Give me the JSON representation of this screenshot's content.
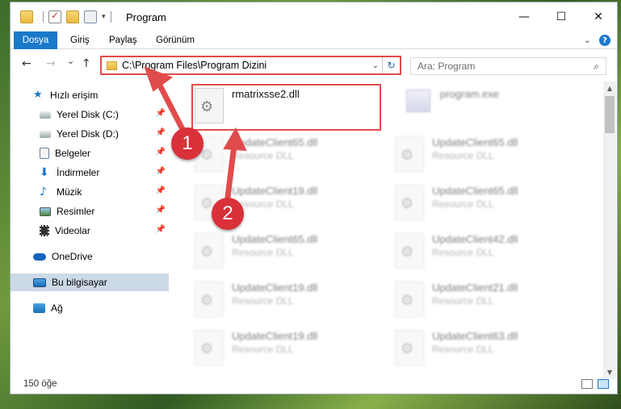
{
  "window": {
    "title": "Program",
    "controls": {
      "minimize": "—",
      "maximize": "☐",
      "close": "✕"
    }
  },
  "ribbon": {
    "tabs": [
      "Dosya",
      "Giriş",
      "Paylaş",
      "Görünüm"
    ],
    "expand_icon": "chevron-down-icon",
    "help_label": "?"
  },
  "navigation": {
    "back": "←",
    "forward": "→",
    "recent": "⌄",
    "up": "↑",
    "address": "C:\\Program Files\\Program Dizini",
    "search_placeholder": "Ara: Program"
  },
  "sidebar": {
    "items": [
      {
        "label": "Hızlı erişim",
        "icon": "star-icon",
        "pinned": false
      },
      {
        "label": "Yerel Disk (C:)",
        "icon": "drive-icon",
        "pinned": true
      },
      {
        "label": "Yerel Disk (D:)",
        "icon": "drive-icon",
        "pinned": true
      },
      {
        "label": "Belgeler",
        "icon": "documents-icon",
        "pinned": true
      },
      {
        "label": "İndirmeler",
        "icon": "download-icon",
        "pinned": true
      },
      {
        "label": "Müzik",
        "icon": "music-icon",
        "pinned": true
      },
      {
        "label": "Resimler",
        "icon": "pictures-icon",
        "pinned": true
      },
      {
        "label": "Videolar",
        "icon": "videos-icon",
        "pinned": true
      },
      {
        "label": "OneDrive",
        "icon": "cloud-icon",
        "pinned": false
      },
      {
        "label": "Bu bilgisayar",
        "icon": "computer-icon",
        "pinned": false
      },
      {
        "label": "Ağ",
        "icon": "network-icon",
        "pinned": false
      }
    ],
    "pin_glyph": "📌"
  },
  "files": [
    {
      "name": "rmatrixsse2.dll",
      "type": "",
      "blurred": false
    },
    {
      "name": "program.exe",
      "type": "",
      "blurred": true
    },
    {
      "name": "UpdateClient65.dll",
      "type": "Resource DLL",
      "blurred": true
    },
    {
      "name": "UpdateClient65.dll",
      "type": "Resource DLL",
      "blurred": true
    },
    {
      "name": "UpdateClient19.dll",
      "type": "Resource DLL",
      "blurred": true
    },
    {
      "name": "UpdateClient65.dll",
      "type": "Resource DLL",
      "blurred": true
    },
    {
      "name": "UpdateClient65.dll",
      "type": "Resource DLL",
      "blurred": true
    },
    {
      "name": "UpdateClient42.dll",
      "type": "Resource DLL",
      "blurred": true
    },
    {
      "name": "UpdateClient19.dll",
      "type": "Resource DLL",
      "blurred": true
    },
    {
      "name": "UpdateClient21.dll",
      "type": "Resource DLL",
      "blurred": true
    },
    {
      "name": "UpdateClient19.dll",
      "type": "Resource DLL",
      "blurred": true
    },
    {
      "name": "UpdateClient63.dll",
      "type": "Resource DLL",
      "blurred": true
    }
  ],
  "status": {
    "count": "150 öğe"
  },
  "annotations": {
    "step1": "1",
    "step2": "2",
    "highlight_color": "#e14b4b",
    "badge_color": "#d9303a"
  },
  "colors": {
    "accent": "#1979ca",
    "selected": "#ccd9e6"
  }
}
